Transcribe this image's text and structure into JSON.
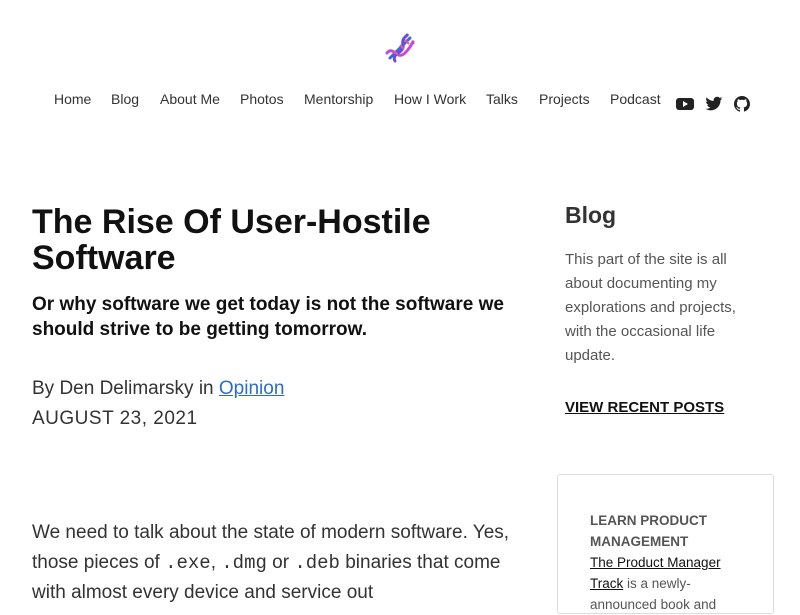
{
  "site": {
    "logo_icon": "dna-icon"
  },
  "nav": {
    "items": [
      {
        "label": "Home"
      },
      {
        "label": "Blog"
      },
      {
        "label": "About Me"
      },
      {
        "label": "Photos"
      },
      {
        "label": "Mentorship"
      },
      {
        "label": "How I Work"
      },
      {
        "label": "Talks"
      },
      {
        "label": "Projects"
      },
      {
        "label": "Podcast"
      }
    ],
    "social": [
      "youtube-icon",
      "twitter-icon",
      "github-icon"
    ]
  },
  "article": {
    "title": "The Rise Of User-Hostile Software",
    "subtitle": "Or why software we get today is not the software we should strive to be getting tomorrow.",
    "byline_prefix": "By Den Delimarsky in ",
    "category": "Opinion",
    "date": "AUGUST 23, 2021",
    "body": {
      "part1": "We need to talk about the state of modern software. Yes, those pieces of ",
      "code1": ".exe",
      "sep1": ", ",
      "code2": ".dmg",
      "sep2": " or ",
      "code3": ".deb",
      "part2": " binaries that come with almost every device and service out"
    }
  },
  "sidebar": {
    "heading": "Blog",
    "description": "This part of the site is all about documenting my explorations and projects, with the occasional life update.",
    "link_label": "VIEW RECENT POSTS"
  },
  "promo": {
    "heading": "LEARN PRODUCT MANAGEMENT",
    "link_label": "The Product Manager Track",
    "text": " is a newly-announced book and"
  },
  "colors": {
    "link": "#2a6bd1",
    "text": "#333333"
  }
}
